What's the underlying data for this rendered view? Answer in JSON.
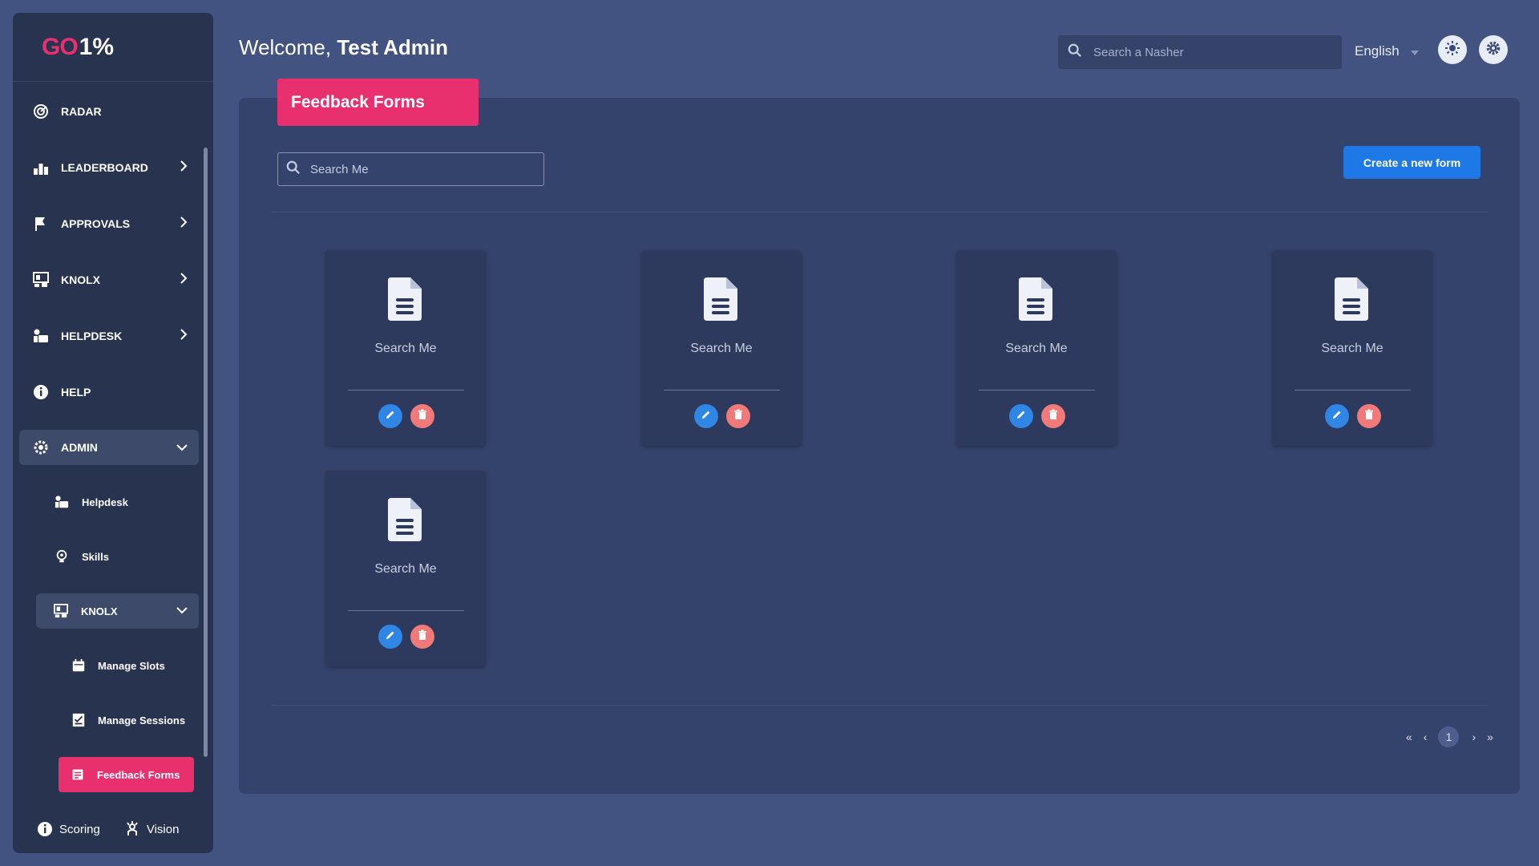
{
  "logo": {
    "go": "GO",
    "pct": "1%"
  },
  "sidebar": {
    "items": [
      {
        "label": "RADAR",
        "icon": "radar-icon"
      },
      {
        "label": "LEADERBOARD",
        "icon": "leaderboard-icon"
      },
      {
        "label": "APPROVALS",
        "icon": "approvals-icon"
      },
      {
        "label": "KNOLX",
        "icon": "knolx-icon"
      },
      {
        "label": "HELPDESK",
        "icon": "helpdesk-icon"
      },
      {
        "label": "HELP",
        "icon": "info-icon"
      },
      {
        "label": "ADMIN",
        "icon": "admin-gear-icon"
      }
    ],
    "admin_sub": [
      {
        "label": "Helpdesk"
      },
      {
        "label": "Skills"
      },
      {
        "label": "KNOLX"
      }
    ],
    "knolx_sub": [
      {
        "label": "Manage Slots"
      },
      {
        "label": "Manage Sessions"
      },
      {
        "label": "Feedback Forms"
      }
    ],
    "footer": {
      "scoring": "Scoring",
      "vision": "Vision"
    }
  },
  "header": {
    "welcome_prefix": "Welcome, ",
    "welcome_name": "Test Admin",
    "search_placeholder": "Search a Nasher",
    "language": "English"
  },
  "main": {
    "page_tag": "Feedback Forms",
    "search_value": "Search Me",
    "create_button": "Create a new form",
    "cards": [
      {
        "title": "Search Me"
      },
      {
        "title": "Search Me"
      },
      {
        "title": "Search Me"
      },
      {
        "title": "Search Me"
      },
      {
        "title": "Search Me"
      }
    ],
    "pagination": {
      "first": "«",
      "prev": "‹",
      "current": "1",
      "next": "›",
      "last": "»"
    }
  },
  "colors": {
    "accent": "#e9306f",
    "primary": "#1e78e6",
    "background": "#425382",
    "sidebar": "#28334f"
  }
}
